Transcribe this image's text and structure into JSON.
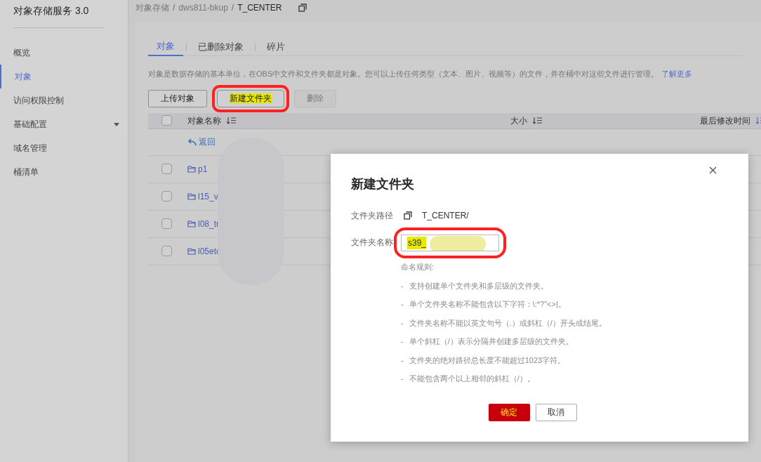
{
  "sidebar": {
    "title": "对象存储服务 3.0",
    "items": [
      {
        "label": "概览",
        "selected": false,
        "expandable": false
      },
      {
        "label": "对象",
        "selected": true,
        "expandable": false
      },
      {
        "label": "访问权限控制",
        "selected": false,
        "expandable": false
      },
      {
        "label": "基础配置",
        "selected": false,
        "expandable": true
      },
      {
        "label": "域名管理",
        "selected": false,
        "expandable": false
      },
      {
        "label": "桶清单",
        "selected": false,
        "expandable": false
      }
    ]
  },
  "breadcrumb": [
    {
      "label": "对象存储"
    },
    {
      "separator": "/",
      "label": "dws811-bkup"
    },
    {
      "separator": "/",
      "label": "T_CENTER"
    }
  ],
  "tabs": [
    {
      "label": "对象",
      "selected": true
    },
    {
      "label": "已删除对象",
      "selected": false
    },
    {
      "label": "碎片",
      "selected": false
    }
  ],
  "description": "对象是数据存储的基本单位，在OBS中文件和文件夹都是对象。您可以上传任何类型（文本、图片、视频等）的文件，并在桶中对这些文件进行管理。",
  "learn_more": "了解更多",
  "actions": [
    {
      "label": "上传对象",
      "disabled": false,
      "annotated": false
    },
    {
      "label": "新建文件夹",
      "disabled": false,
      "annotated": true
    },
    {
      "label": "删除",
      "disabled": true,
      "annotated": false
    }
  ],
  "table": {
    "header_checked": false,
    "columns": [
      "对象名称",
      "大小",
      "最后修改时间"
    ],
    "back": "返回",
    "rows": [
      {
        "name": "p1",
        "checked": false
      },
      {
        "name": "l15_v",
        "checked": false
      },
      {
        "name": "l08_tr",
        "checked": false
      },
      {
        "name": "l05etc",
        "checked": false
      }
    ]
  },
  "dialog": {
    "title": "新建文件夹",
    "path_label": "文件夹路径",
    "path": "T_CENTER/",
    "name_label": "文件夹名称",
    "name_value": "s39_",
    "rules_title": "命名规则:",
    "rules": [
      {
        "bullet": "-",
        "text": "支持创建单个文件夹和多层级的文件夹。"
      },
      {
        "bullet": "-",
        "text": "单个文件夹名称不能包含以下字符：\\:*?\"<>|。"
      },
      {
        "bullet": "-",
        "text": "文件夹名称不能以英文句号（.）或斜杠（/）开头或结尾。"
      },
      {
        "bullet": "-",
        "text": "单个斜杠（/）表示分隔并创建多层级的文件夹。"
      },
      {
        "bullet": "-",
        "text": "文件夹的绝对路径总长度不能超过1023字符。"
      },
      {
        "bullet": "-",
        "text": "不能包含两个以上相邻的斜杠（/）。"
      }
    ],
    "confirm": "确定",
    "cancel": "取消"
  }
}
